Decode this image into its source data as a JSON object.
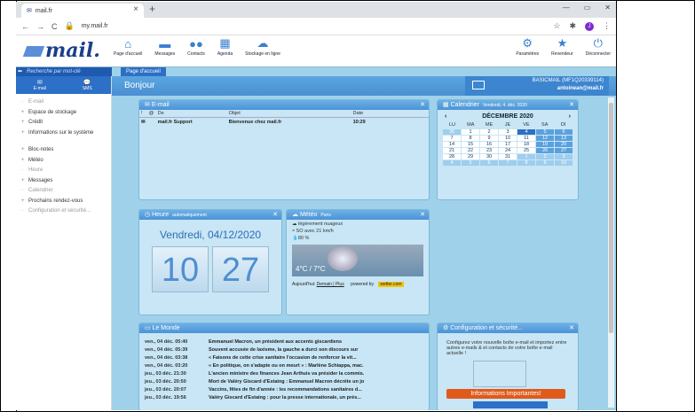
{
  "browser": {
    "tab_title": "mail.fr",
    "url": "my.mail.fr",
    "profile_initial": "J",
    "window_controls": [
      "—",
      "▭",
      "✕"
    ]
  },
  "app": {
    "logo": "mail.",
    "nav": [
      {
        "label": "Page d'accueil",
        "icon": "home-icon"
      },
      {
        "label": "Messages",
        "icon": "envelope-icon"
      },
      {
        "label": "Contacts",
        "icon": "contacts-icon"
      },
      {
        "label": "Agenda",
        "icon": "calendar-icon"
      },
      {
        "label": "Stockage en ligne",
        "icon": "cloud-icon"
      }
    ],
    "right_nav": [
      {
        "label": "Paramètres",
        "icon": "gear-icon"
      },
      {
        "label": "Revendeur",
        "icon": "star-icon"
      },
      {
        "label": "Déconnecter",
        "icon": "power-icon"
      }
    ],
    "search_placeholder": "Recherche par mot-clé",
    "side_tabs": [
      "E-mail",
      "SMS"
    ],
    "side_items": [
      "E-mail",
      "Espace de stockage",
      "Crédit",
      "Informations sur le système",
      "Bloc-notes",
      "Météo",
      "Heure",
      "Messages",
      "Calendrier",
      "Prochains rendez-vous",
      "Configuration et sécurité..."
    ],
    "main_tab": "Page d'accueil",
    "greeting": "Bonjour",
    "account": {
      "plan": "BASICMAIL (MF1Q20339114)",
      "email": "antoinean@mail.fr"
    }
  },
  "email_widget": {
    "title": "E-mail",
    "columns": [
      "!",
      "@",
      "De",
      "Objet",
      "Date"
    ],
    "rows": [
      {
        "from": "mail.fr Support",
        "subject": "Bienvenue chez mail.fr",
        "date": "10:29"
      }
    ]
  },
  "calendar_widget": {
    "title": "Calendrier",
    "subtitle": "Vendredi, 4. déc. 2020",
    "month": "DÉCEMBRE 2020",
    "day_names": [
      "LU",
      "MA",
      "ME",
      "JE",
      "VE",
      "SA",
      "DI"
    ],
    "weeks": [
      [
        "30",
        "1",
        "2",
        "3",
        "4",
        "5",
        "6"
      ],
      [
        "7",
        "8",
        "9",
        "10",
        "11",
        "12",
        "13"
      ],
      [
        "14",
        "15",
        "16",
        "17",
        "18",
        "19",
        "20"
      ],
      [
        "21",
        "22",
        "23",
        "24",
        "25",
        "26",
        "27"
      ],
      [
        "28",
        "29",
        "30",
        "31",
        "1",
        "2",
        "3"
      ],
      [
        "4",
        "5",
        "6",
        "7",
        "8",
        "9",
        "10"
      ]
    ],
    "today": "4"
  },
  "time_widget": {
    "title": "Heure",
    "subtitle": "automatiquement",
    "date": "Vendredi, 04/12/2020",
    "hours": "10",
    "minutes": "27"
  },
  "weather_widget": {
    "title": "Météo",
    "subtitle": "Paris",
    "condition": "légèrement nuageux",
    "wind": "SO avec 21 km/h",
    "humidity": "80 %",
    "temperature": "4°C / 7°C",
    "today_label": "Aujourd'hui",
    "links": "Demain | Plus",
    "powered": "powered by",
    "brand": "wetter.com"
  },
  "news_widget": {
    "title": "Le Monde",
    "items": [
      {
        "time": "ven., 04 déc. 05:40",
        "headline": "Emmanuel Macron, un président aux accents giscardiens"
      },
      {
        "time": "ven., 04 déc. 05:39",
        "headline": "Souvent accusée de laxisme, la gauche a durci son discours sur"
      },
      {
        "time": "ven., 04 déc. 03:38",
        "headline": "« Faisons de cette crise sanitaire l'occasion de renforcer la vit..."
      },
      {
        "time": "ven., 04 déc. 03:20",
        "headline": "« En politique, on s'adapte ou on meurt » : Marlène Schiappa, mac."
      },
      {
        "time": "jeu., 03 déc. 21:30",
        "headline": "L'ancien ministre des finances Jean Arthuis va présider la commis."
      },
      {
        "time": "jeu., 03 déc. 20:50",
        "headline": "Mort de Valéry Giscard d'Estaing : Emmanuel Macron décrète un jo"
      },
      {
        "time": "jeu., 03 déc. 20:07",
        "headline": "Vaccins, fêtes de fin d'année : les recommandations sanitaires d..."
      },
      {
        "time": "jeu., 03 déc. 19:56",
        "headline": "Valéry Giscard d'Estaing : pour la presse internationale, un prés..."
      }
    ]
  },
  "config_widget": {
    "title": "Configuration et sécurité...",
    "text": "Configurez votre nouvelle boîte e-mail et importez entre autres e-mails & et contacts de votre boîte e-mail actuelle !",
    "button": "Informations Importantes!"
  }
}
